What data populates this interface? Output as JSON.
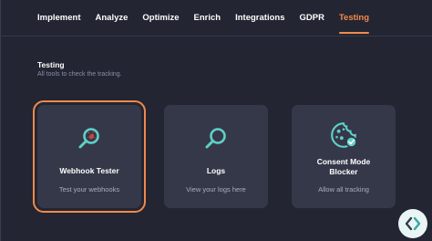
{
  "nav": {
    "tabs": [
      {
        "label": "Implement"
      },
      {
        "label": "Analyze"
      },
      {
        "label": "Optimize"
      },
      {
        "label": "Enrich"
      },
      {
        "label": "Integrations"
      },
      {
        "label": "GDPR"
      },
      {
        "label": "Testing"
      }
    ],
    "active_tab": "Testing"
  },
  "section": {
    "title": "Testing",
    "subtitle": "All tools to check the tracking."
  },
  "cards": [
    {
      "title": "Webhook Tester",
      "desc": "Test your webhooks",
      "icon": "magnifier-bug-icon",
      "highlighted": true
    },
    {
      "title": "Logs",
      "desc": "View your logs here",
      "icon": "magnifier-icon"
    },
    {
      "title": "Consent Mode Blocker",
      "title_line1": "Consent Mode",
      "title_line2": "Blocker",
      "desc": "Allow all tracking",
      "icon": "cookie-check-icon"
    }
  ],
  "colors": {
    "accent": "#f08a4b",
    "icon_teal": "#5fd0c8",
    "background": "#232532",
    "card": "#353849"
  },
  "fab": {
    "icon": "code-brackets-icon"
  }
}
